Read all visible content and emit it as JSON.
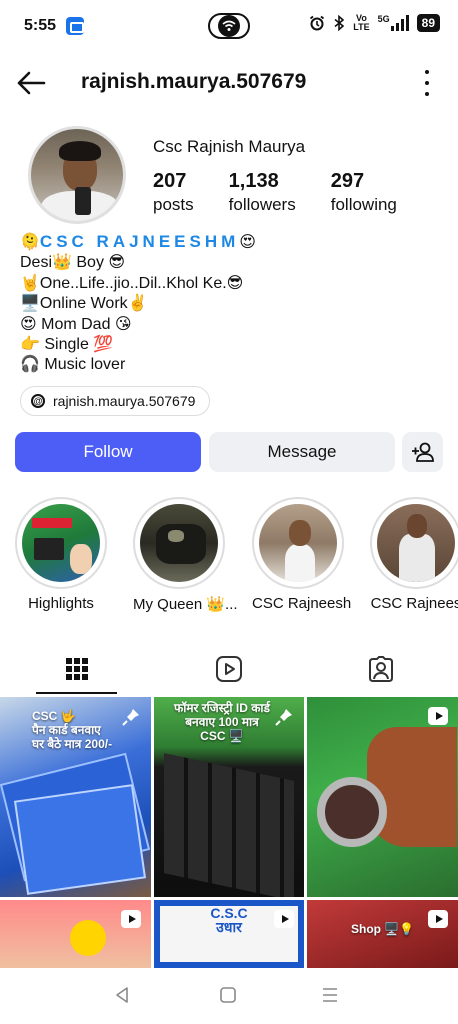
{
  "status_bar": {
    "time": "5:55",
    "volte_top": "Vo",
    "volte_bottom": "LTE",
    "network": "5G",
    "battery": "89"
  },
  "header": {
    "username": "rajnish.maurya.507679"
  },
  "profile": {
    "display_name": "Csc Rajnish Maurya",
    "stats": [
      {
        "value": "207",
        "label": "posts"
      },
      {
        "value": "1,138",
        "label": "followers"
      },
      {
        "value": "297",
        "label": "following"
      }
    ],
    "bio": {
      "title": "CSC RAJNEESHM",
      "title_prefix": "🫠",
      "title_suffix": "😍",
      "lines": [
        "Desi👑 Boy 😎",
        "🤘One..Life..jio..Dil..Khol Ke.😎",
        "🖥️Online Work✌️",
        "😍 Mom Dad 😘",
        "👉 Single 💯",
        "🎧 Music lover"
      ]
    },
    "threads_handle": "rajnish.maurya.507679"
  },
  "actions": {
    "follow": "Follow",
    "message": "Message"
  },
  "highlights": [
    {
      "label": "Highlights"
    },
    {
      "label": "My Queen 👑..."
    },
    {
      "label": "CSC Rajneesh"
    },
    {
      "label": "CSC Rajnees"
    }
  ],
  "grid": {
    "posts": [
      {
        "text": "CSC 🤟\nपैन कार्ड बनवाए\nघर बैठे मात्र 200/-",
        "icon": "pin-icon"
      },
      {
        "text": "फॉमर रजिस्ट्री ID कार्ड\nबनवाए 100 मात्र\nCSC 🖥️",
        "icon": "pin-icon"
      },
      {
        "text": "",
        "icon": "reel-icon"
      },
      {
        "text": "",
        "icon": "reel-icon"
      },
      {
        "text": "C.S.C\nउधार",
        "icon": "reel-icon"
      },
      {
        "text": "Shop 🖥️💡",
        "icon": "reel-icon"
      }
    ]
  },
  "colors": {
    "accent": "#4d5ef6",
    "bio_title": "#1e88e5",
    "button_bg": "#eef0f3"
  }
}
